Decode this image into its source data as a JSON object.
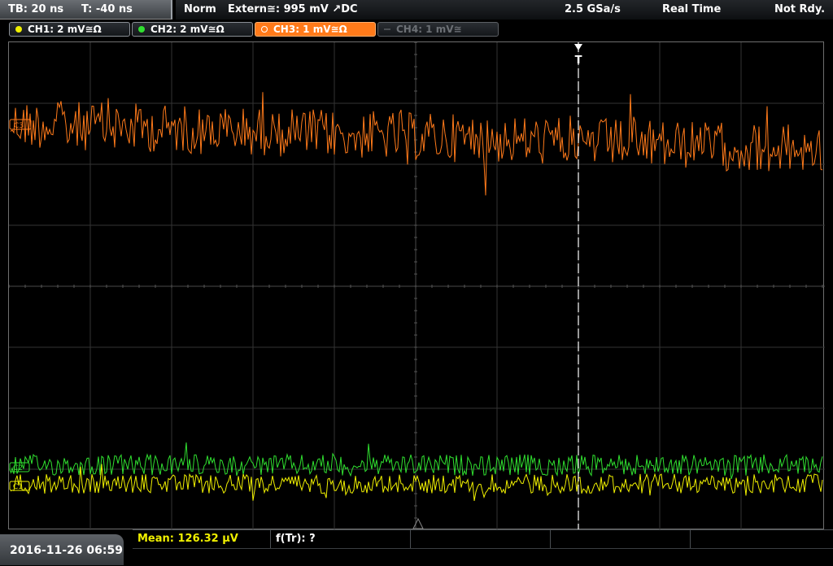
{
  "timebase": {
    "tb": "TB: 20 ns",
    "trigger_offset": "T: -40 ns"
  },
  "status": {
    "mode": "Norm",
    "trigger_source": "Extern≅: 995 mV ↗DC",
    "sample_rate": "2.5 GSa/s",
    "acq_mode": "Real Time",
    "state": "Not Rdy."
  },
  "channels": [
    {
      "label": "CH1: 2 mV≅Ω",
      "color": "#f0f000",
      "state": "on"
    },
    {
      "label": "CH2: 2 mV≅Ω",
      "color": "#30e030",
      "state": "on"
    },
    {
      "label": "CH3: 1 mV≅Ω",
      "color": "#ff7a1a",
      "state": "active"
    },
    {
      "label": "CH4: 1 mV≅",
      "color": "#6c7075",
      "state": "off"
    }
  ],
  "markers": {
    "ch3": "C3",
    "ch2": "C2",
    "ch1": "C1",
    "trigger": "T"
  },
  "footer": {
    "datetime": "2016-11-26 06:59",
    "mean": "Mean: 126.32 µV",
    "f_tr": "f(Tr): ?"
  }
}
